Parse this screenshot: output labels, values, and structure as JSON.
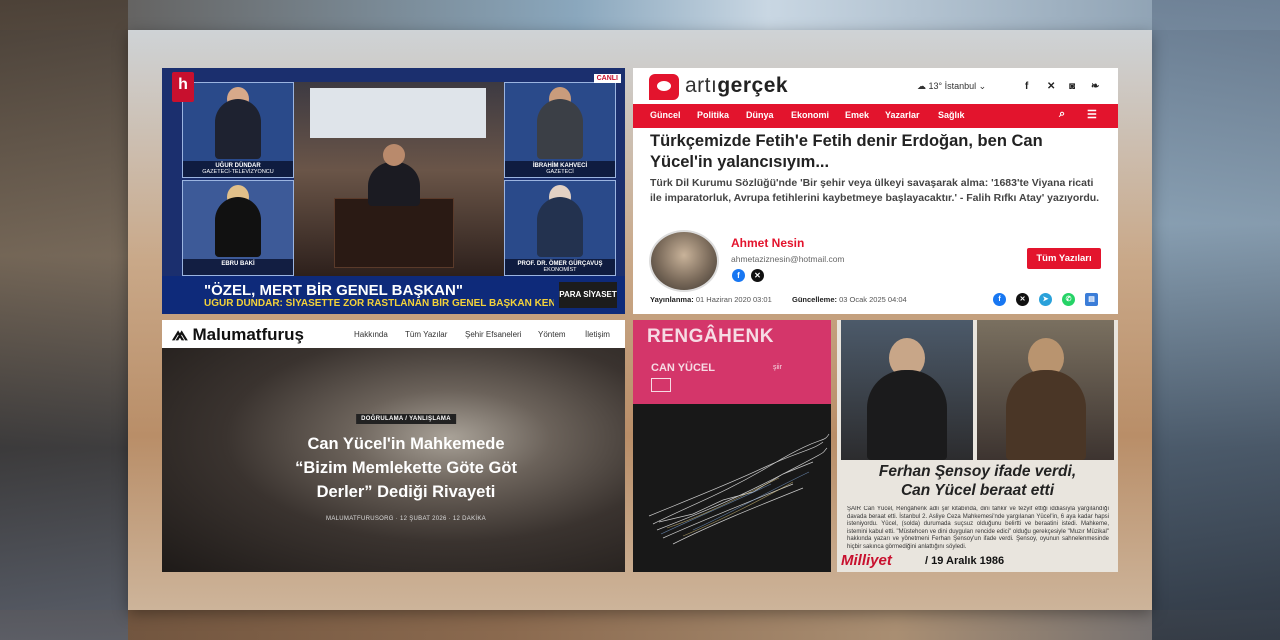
{
  "halktv": {
    "logo": "h",
    "live": "CANLI",
    "headline": "\"ÖZEL, MERT BİR GENEL BAŞKAN\"",
    "ticker": "UĞUR DÜNDAR: SİYASETTE ZOR RASTLANAN BİR GENEL BAŞKAN KENDİSİ",
    "badge": "PARA SİYASET",
    "guests": [
      {
        "name": "UĞUR DÜNDAR",
        "role": "GAZETECİ-TELEVİZYONCU"
      },
      {
        "name": "İBRAHİM KAHVECİ",
        "role": "GAZETECİ"
      },
      {
        "name": "EBRU BAKİ",
        "role": ""
      },
      {
        "name": "PROF. DR. ÖMER GÜRÇAVUŞ",
        "role": "EKONOMİST"
      }
    ]
  },
  "artigercek": {
    "brand_a": "artı",
    "brand_b": "gerçek",
    "weather": "13° İstanbul",
    "nav": [
      "Güncel",
      "Politika",
      "Dünya",
      "Ekonomi",
      "Emek",
      "Yazarlar",
      "Sağlık"
    ],
    "headline": "Türkçemizde Fetih'e Fetih denir Erdoğan, ben Can Yücel'in yalancısıyım...",
    "lead": "Türk Dil Kurumu Sözlüğü'nde 'Bir şehir veya ülkeyi savaşarak alma: '1683'te Viyana ricati ile imparatorluk, Avrupa fetihlerini kaybetmeye başlayacaktır.' - Falih Rıfkı Atay' yazıyordu.",
    "author": "Ahmet Nesin",
    "email": "ahmetaziznesin@hotmail.com",
    "all_posts_button": "Tüm Yazıları",
    "published_label": "Yayınlanma:",
    "published_value": "01 Haziran 2020 03:01",
    "updated_label": "Güncelleme:",
    "updated_value": "03 Ocak 2025 04:04"
  },
  "malumatfurus": {
    "logo": "Malumatfuruş",
    "nav": [
      "Hakkında",
      "Tüm Yazılar",
      "Şehir Efsaneleri",
      "Yöntem",
      "İletişim"
    ],
    "category": "DOĞRULAMA / YANLIŞLAMA",
    "title": "Can Yücel'in Mahkemede “Bizim Memlekette Göte Göt Derler” Dediği Rivayeti",
    "meta": "MALUMATFURUSORG  ·  12 ŞUBAT 2026  ·  12 DAKİKA"
  },
  "book": {
    "title": "RENGÂHENK",
    "author": "CAN YÜCEL",
    "subtitle": "şiir"
  },
  "milliyet": {
    "headline_1": "Ferhan Şensoy ifade verdi,",
    "headline_2": "Can Yücel beraat etti",
    "body": "ŞAİR Can Yücel, Rengâhenk adlı şiir kitabında, dini tahkir ve tezyif ettiği iddiasıyla yargılandığı davada beraat etti. İstanbul 2. Asliye Ceza Mahkemesi'nde yargılanan Yücel'in, 6 aya kadar hapsi isteniyordu. Yücel, (solda) durumada suçsuz olduğunu belirtti ve beraatini istedi. Mahkeme, istemini kabul etti. \"Müstehcen ve dini duyguları rencide edici\" olduğu gerekçesiyle \"Muzır Müzikal\" hakkında yazarı ve yönetmeni Ferhan Şensoy'un ifade verdi. Şensoy, oyunun sahnelenmesinde hiçbir sakınca görmediğini anlattığını söyledi.",
    "paper": "Milliyet",
    "date": "/ 19 Aralık 1986"
  }
}
